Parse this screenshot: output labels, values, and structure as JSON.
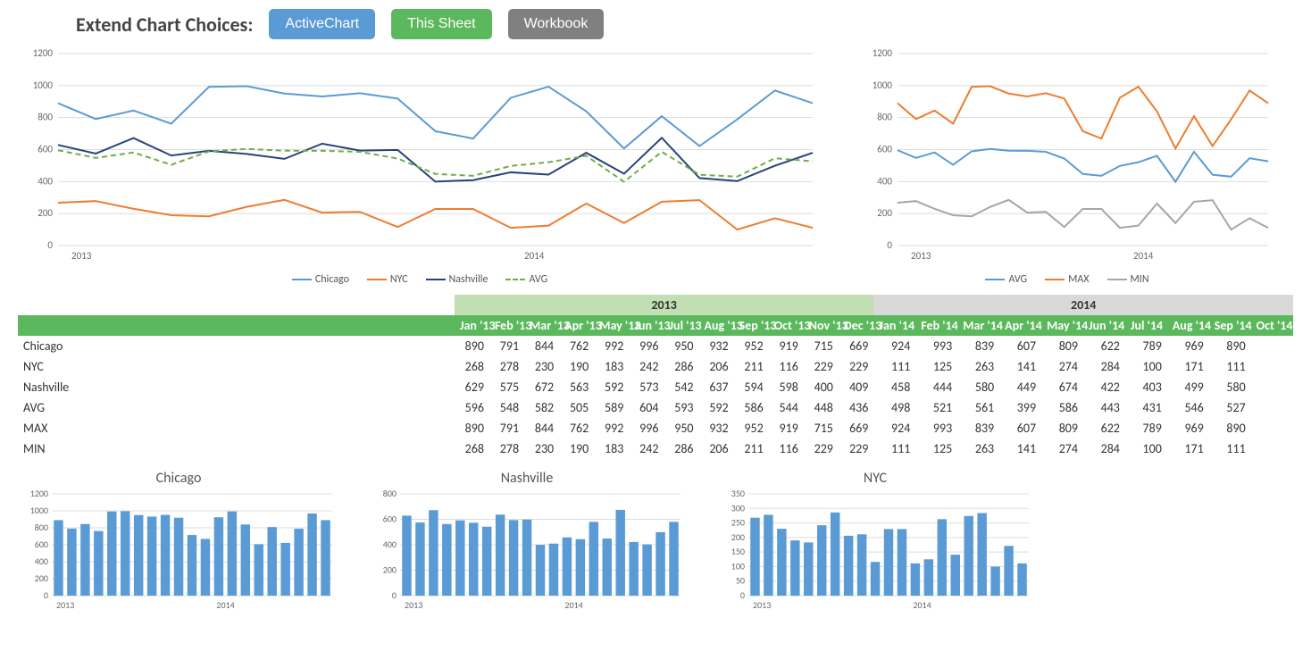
{
  "header": {
    "title": "Extend Chart Choices:",
    "btn_active": "ActiveChart",
    "btn_sheet": "This Sheet",
    "btn_workbook": "Workbook"
  },
  "months": [
    "Jan '13",
    "Feb '13",
    "Mar '13",
    "Apr '13",
    "May '13",
    "Jun '13",
    "Jul '13",
    "Aug '13",
    "Sep '13",
    "Oct '13",
    "Nov '13",
    "Dec '13",
    "Jan '14",
    "Feb '14",
    "Mar '14",
    "Apr '14",
    "May '14",
    "Jun '14",
    "Jul '14",
    "Aug '14",
    "Sep '14",
    "Oct '14"
  ],
  "year_headers": [
    "",
    "2013",
    "2014"
  ],
  "rows": [
    {
      "label": "Chicago",
      "values": [
        890,
        791,
        844,
        762,
        992,
        996,
        950,
        932,
        952,
        919,
        715,
        669,
        924,
        993,
        839,
        607,
        809,
        622,
        789,
        969,
        890,
        null
      ]
    },
    {
      "label": "NYC",
      "values": [
        268,
        278,
        230,
        190,
        183,
        242,
        286,
        206,
        211,
        116,
        229,
        229,
        111,
        125,
        263,
        141,
        274,
        284,
        100,
        171,
        111,
        null
      ]
    },
    {
      "label": "Nashville",
      "values": [
        629,
        575,
        672,
        563,
        592,
        573,
        542,
        637,
        594,
        598,
        400,
        409,
        458,
        444,
        580,
        449,
        674,
        422,
        403,
        499,
        580,
        null
      ]
    },
    {
      "label": "AVG",
      "values": [
        596,
        548,
        582,
        505,
        589,
        604,
        593,
        592,
        586,
        544,
        448,
        436,
        498,
        521,
        561,
        399,
        586,
        443,
        431,
        546,
        527,
        null
      ]
    },
    {
      "label": "MAX",
      "values": [
        890,
        791,
        844,
        762,
        992,
        996,
        950,
        932,
        952,
        919,
        715,
        669,
        924,
        993,
        839,
        607,
        809,
        622,
        789,
        969,
        890,
        null
      ]
    },
    {
      "label": "MIN",
      "values": [
        268,
        278,
        230,
        190,
        183,
        242,
        286,
        206,
        211,
        116,
        229,
        229,
        111,
        125,
        263,
        141,
        274,
        284,
        100,
        171,
        111,
        null
      ]
    }
  ],
  "chart_data": [
    {
      "type": "line",
      "title": "",
      "xlabel": "",
      "ylabel": "",
      "xlim": [
        "2013",
        "2014"
      ],
      "ylim": [
        0,
        1200
      ],
      "yticks": [
        0,
        200,
        400,
        600,
        800,
        1000,
        1200
      ],
      "xticks": [
        "2013",
        "2014"
      ],
      "categories": [
        "Jan '13",
        "Feb '13",
        "Mar '13",
        "Apr '13",
        "May '13",
        "Jun '13",
        "Jul '13",
        "Aug '13",
        "Sep '13",
        "Oct '13",
        "Nov '13",
        "Dec '13",
        "Jan '14",
        "Feb '14",
        "Mar '14",
        "Apr '14",
        "May '14",
        "Jun '14",
        "Jul '14",
        "Aug '14",
        "Sep '14"
      ],
      "series": [
        {
          "name": "Chicago",
          "color": "#5b9bd5",
          "style": "solid",
          "values": [
            890,
            791,
            844,
            762,
            992,
            996,
            950,
            932,
            952,
            919,
            715,
            669,
            924,
            993,
            839,
            607,
            809,
            622,
            789,
            969,
            890
          ]
        },
        {
          "name": "NYC",
          "color": "#ed7d31",
          "style": "solid",
          "values": [
            268,
            278,
            230,
            190,
            183,
            242,
            286,
            206,
            211,
            116,
            229,
            229,
            111,
            125,
            263,
            141,
            274,
            284,
            100,
            171,
            111
          ]
        },
        {
          "name": "Nashville",
          "color": "#264478",
          "style": "solid",
          "values": [
            629,
            575,
            672,
            563,
            592,
            573,
            542,
            637,
            594,
            598,
            400,
            409,
            458,
            444,
            580,
            449,
            674,
            422,
            403,
            499,
            580
          ]
        },
        {
          "name": "AVG",
          "color": "#70ad47",
          "style": "dashed",
          "values": [
            596,
            548,
            582,
            505,
            589,
            604,
            593,
            592,
            586,
            544,
            448,
            436,
            498,
            521,
            561,
            399,
            586,
            443,
            431,
            546,
            527
          ]
        }
      ]
    },
    {
      "type": "line",
      "title": "",
      "xlabel": "",
      "ylabel": "",
      "xlim": [
        "2013",
        "2014"
      ],
      "ylim": [
        0,
        1200
      ],
      "yticks": [
        0,
        200,
        400,
        600,
        800,
        1000,
        1200
      ],
      "xticks": [
        "2013",
        "2014"
      ],
      "categories": [
        "Jan '13",
        "Feb '13",
        "Mar '13",
        "Apr '13",
        "May '13",
        "Jun '13",
        "Jul '13",
        "Aug '13",
        "Sep '13",
        "Oct '13",
        "Nov '13",
        "Dec '13",
        "Jan '14",
        "Feb '14",
        "Mar '14",
        "Apr '14",
        "May '14",
        "Jun '14",
        "Jul '14",
        "Aug '14",
        "Sep '14"
      ],
      "series": [
        {
          "name": "AVG",
          "color": "#5b9bd5",
          "style": "solid",
          "values": [
            596,
            548,
            582,
            505,
            589,
            604,
            593,
            592,
            586,
            544,
            448,
            436,
            498,
            521,
            561,
            399,
            586,
            443,
            431,
            546,
            527
          ]
        },
        {
          "name": "MAX",
          "color": "#ed7d31",
          "style": "solid",
          "values": [
            890,
            791,
            844,
            762,
            992,
            996,
            950,
            932,
            952,
            919,
            715,
            669,
            924,
            993,
            839,
            607,
            809,
            622,
            789,
            969,
            890
          ]
        },
        {
          "name": "MIN",
          "color": "#a6a6a6",
          "style": "solid",
          "values": [
            268,
            278,
            230,
            190,
            183,
            242,
            286,
            206,
            211,
            116,
            229,
            229,
            111,
            125,
            263,
            141,
            274,
            284,
            100,
            171,
            111
          ]
        }
      ]
    },
    {
      "type": "bar",
      "title": "Chicago",
      "ylim": [
        0,
        1200
      ],
      "yticks": [
        0,
        200,
        400,
        600,
        800,
        1000,
        1200
      ],
      "xticks": [
        "2013",
        "2014"
      ],
      "color": "#5b9bd5",
      "categories": [
        "Jan '13",
        "Feb '13",
        "Mar '13",
        "Apr '13",
        "May '13",
        "Jun '13",
        "Jul '13",
        "Aug '13",
        "Sep '13",
        "Oct '13",
        "Nov '13",
        "Dec '13",
        "Jan '14",
        "Feb '14",
        "Mar '14",
        "Apr '14",
        "May '14",
        "Jun '14",
        "Jul '14",
        "Aug '14",
        "Sep '14"
      ],
      "values": [
        890,
        791,
        844,
        762,
        992,
        996,
        950,
        932,
        952,
        919,
        715,
        669,
        924,
        993,
        839,
        607,
        809,
        622,
        789,
        969,
        890
      ]
    },
    {
      "type": "bar",
      "title": "Nashville",
      "ylim": [
        0,
        800
      ],
      "yticks": [
        0,
        200,
        400,
        600,
        800
      ],
      "xticks": [
        "2013",
        "2014"
      ],
      "color": "#5b9bd5",
      "categories": [
        "Jan '13",
        "Feb '13",
        "Mar '13",
        "Apr '13",
        "May '13",
        "Jun '13",
        "Jul '13",
        "Aug '13",
        "Sep '13",
        "Oct '13",
        "Nov '13",
        "Dec '13",
        "Jan '14",
        "Feb '14",
        "Mar '14",
        "Apr '14",
        "May '14",
        "Jun '14",
        "Jul '14",
        "Aug '14",
        "Sep '14"
      ],
      "values": [
        629,
        575,
        672,
        563,
        592,
        573,
        542,
        637,
        594,
        598,
        400,
        409,
        458,
        444,
        580,
        449,
        674,
        422,
        403,
        499,
        580
      ]
    },
    {
      "type": "bar",
      "title": "NYC",
      "ylim": [
        0,
        350
      ],
      "yticks": [
        0,
        50,
        100,
        150,
        200,
        250,
        300,
        350
      ],
      "xticks": [
        "2013",
        "2014"
      ],
      "color": "#5b9bd5",
      "categories": [
        "Jan '13",
        "Feb '13",
        "Mar '13",
        "Apr '13",
        "May '13",
        "Jun '13",
        "Jul '13",
        "Aug '13",
        "Sep '13",
        "Oct '13",
        "Nov '13",
        "Dec '13",
        "Jan '14",
        "Feb '14",
        "Mar '14",
        "Apr '14",
        "May '14",
        "Jun '14",
        "Jul '14",
        "Aug '14",
        "Sep '14"
      ],
      "values": [
        268,
        278,
        230,
        190,
        183,
        242,
        286,
        206,
        211,
        116,
        229,
        229,
        111,
        125,
        263,
        141,
        274,
        284,
        100,
        171,
        111
      ]
    }
  ]
}
